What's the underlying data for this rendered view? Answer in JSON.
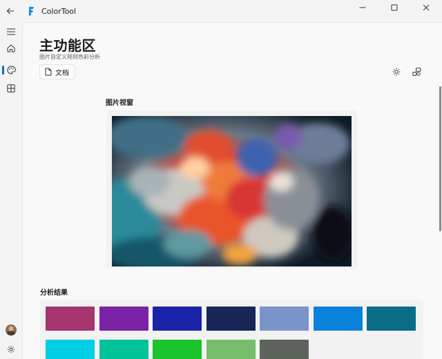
{
  "app": {
    "title": "ColorTool"
  },
  "nav": {
    "items": [
      "menu",
      "home",
      "palette",
      "dashboard"
    ],
    "selected": "palette"
  },
  "page": {
    "title": "主功能区",
    "subtitle": "图片自定义规则色彩分析"
  },
  "toolbar": {
    "doc_label": "文档"
  },
  "viewer": {
    "title": "图片视窗"
  },
  "results": {
    "title": "分析结果",
    "colors": [
      "#a4356f",
      "#7b22a6",
      "#1a22a8",
      "#162656",
      "#7a94c9",
      "#0a82dc",
      "#0b6c87",
      "#00cfe6",
      "#00c39a",
      "#19c42d",
      "#76bd6c",
      "#5d645c"
    ]
  }
}
